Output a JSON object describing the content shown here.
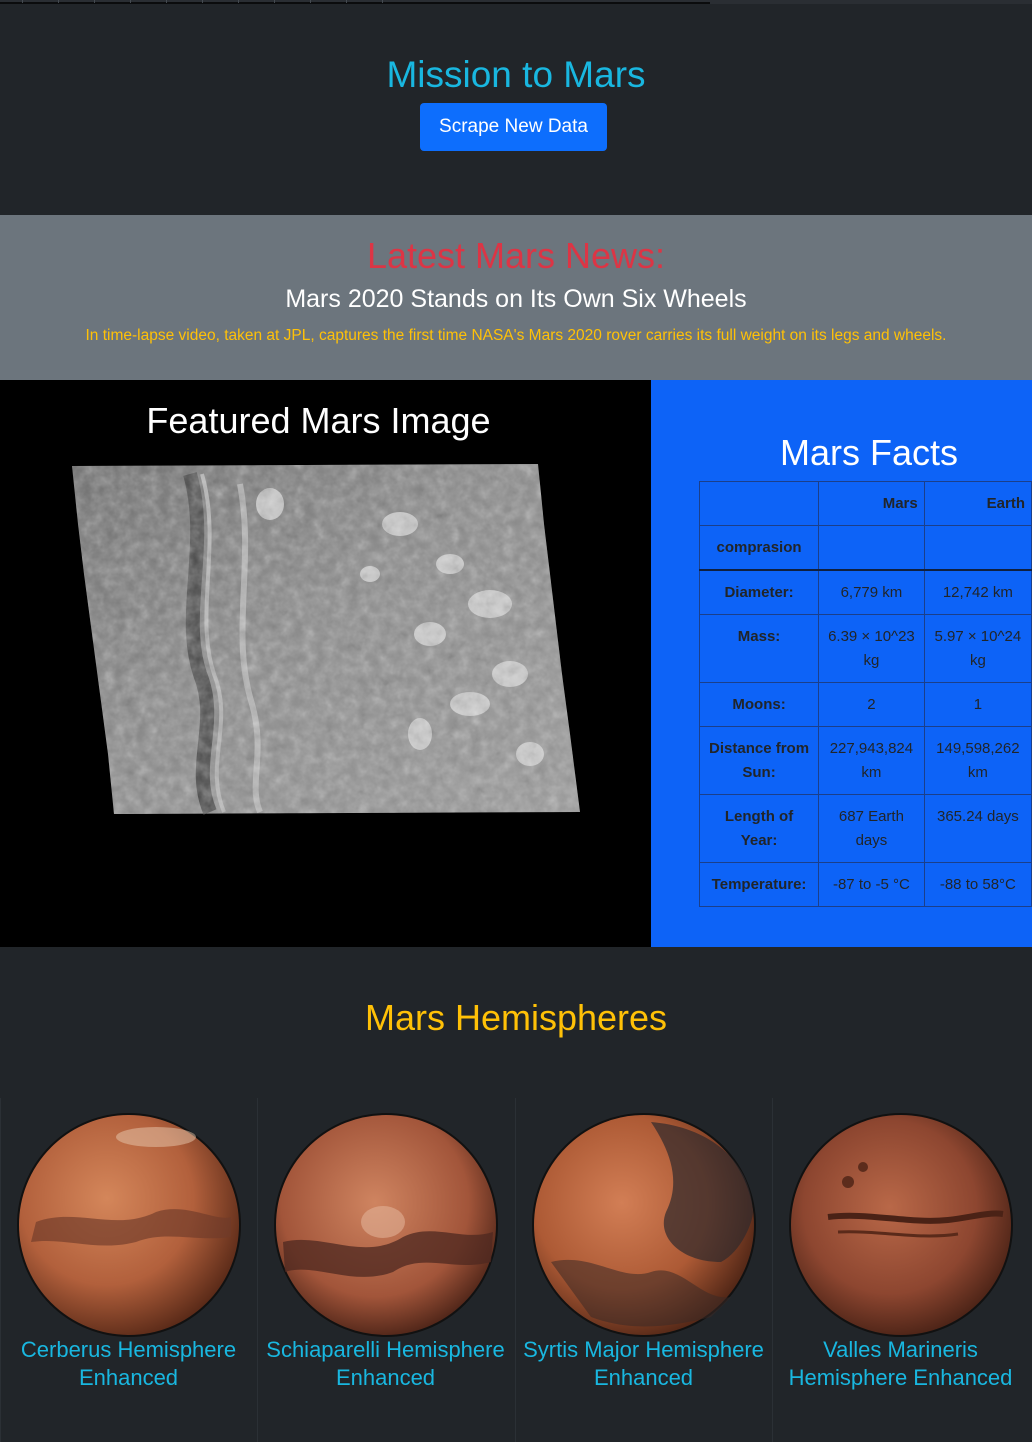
{
  "header": {
    "title": "Mission to Mars",
    "scrape_button": "Scrape New Data"
  },
  "news": {
    "heading": "Latest Mars News:",
    "title": "Mars 2020 Stands on Its Own Six Wheels",
    "teaser": "In time-lapse video, taken at JPL, captures the first time NASA's Mars 2020 rover carries its full weight on its legs and wheels."
  },
  "featured": {
    "heading": "Featured Mars Image"
  },
  "facts": {
    "heading": "Mars Facts",
    "columns": [
      "",
      "Mars",
      "Earth"
    ],
    "subheader": "comprasion",
    "rows": [
      {
        "label": "Diameter:",
        "mars": "6,779 km",
        "earth": "12,742 km"
      },
      {
        "label": "Mass:",
        "mars": "6.39 × 10^23 kg",
        "earth": "5.97 × 10^24 kg"
      },
      {
        "label": "Moons:",
        "mars": "2",
        "earth": "1"
      },
      {
        "label": "Distance from Sun:",
        "mars": "227,943,824 km",
        "earth": "149,598,262 km"
      },
      {
        "label": "Length of Year:",
        "mars": "687 Earth days",
        "earth": "365.24 days"
      },
      {
        "label": "Temperature:",
        "mars": "-87 to -5 °C",
        "earth": "-88 to 58°C"
      }
    ]
  },
  "hemispheres": {
    "heading": "Mars Hemispheres",
    "items": [
      {
        "title": "Cerberus Hemisphere Enhanced"
      },
      {
        "title": "Schiaparelli Hemisphere Enhanced"
      },
      {
        "title": "Syrtis Major Hemisphere Enhanced"
      },
      {
        "title": "Valles Marineris Hemisphere Enhanced"
      }
    ]
  },
  "colors": {
    "accent_cyan": "#19b7e0",
    "news_red": "#dc3545",
    "warning_yellow": "#ffc107",
    "primary_blue": "#0d6efd",
    "dark_bg": "#212529",
    "gray_bg": "#6c757d"
  }
}
